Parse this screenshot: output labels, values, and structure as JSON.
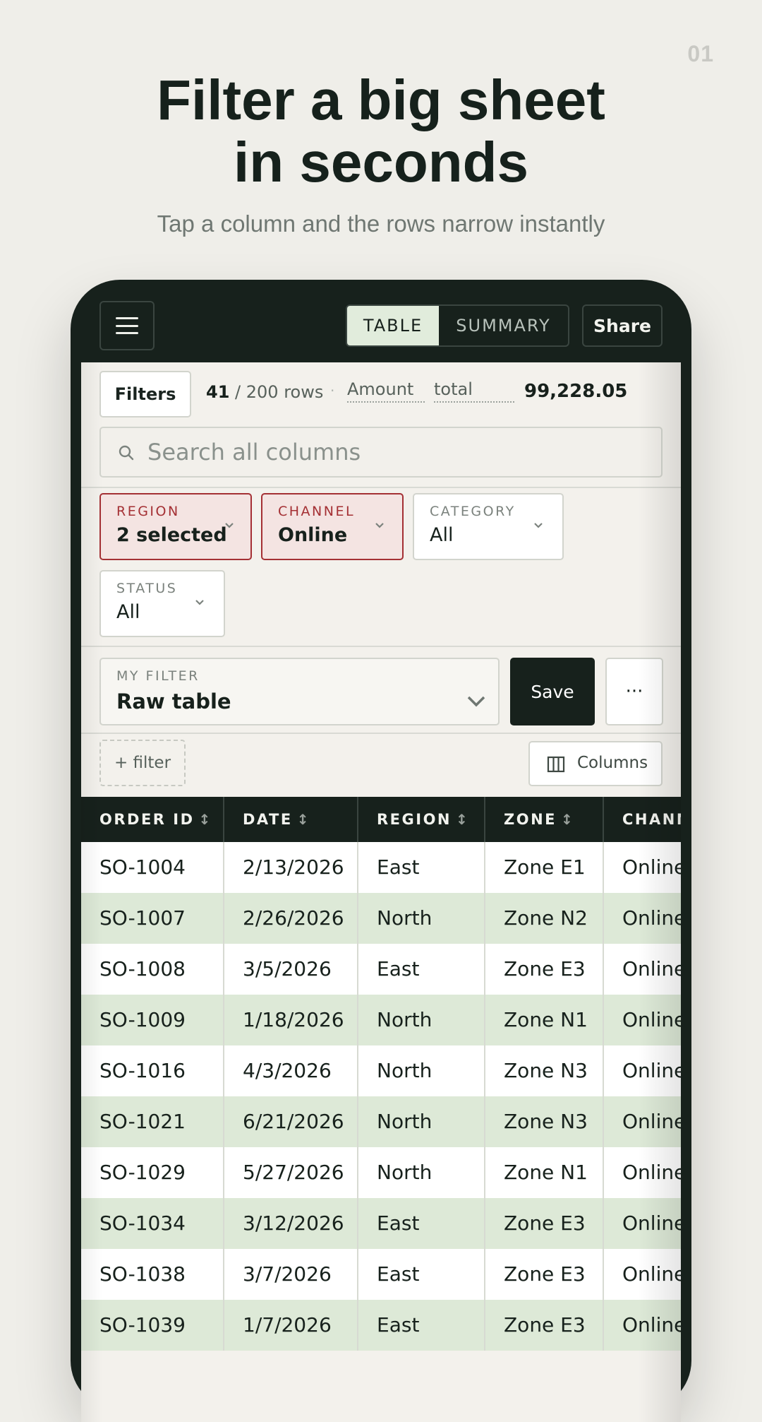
{
  "page_number": "01",
  "hero": {
    "title_line1": "Filter a big sheet",
    "title_line2": "in seconds",
    "subtitle": "Tap a column and the rows narrow instantly"
  },
  "toolbar": {
    "view_tabs": [
      "TABLE",
      "SUMMARY"
    ],
    "active_tab": "TABLE",
    "share_label": "Share"
  },
  "summary": {
    "filters_label": "Filters",
    "rows_shown": "41",
    "rows_total": " / 200 rows",
    "separator": "·",
    "metric_field": "Amount",
    "metric_agg": "total",
    "metric_value": "99,228.05"
  },
  "search": {
    "placeholder": "Search all columns"
  },
  "filter_chips": [
    {
      "label": "REGION",
      "value": "2 selected",
      "active": true
    },
    {
      "label": "CHANNEL",
      "value": "Online",
      "active": true
    },
    {
      "label": "CATEGORY",
      "value": "All",
      "active": false
    },
    {
      "label": "STATUS",
      "value": "All",
      "active": false
    }
  ],
  "saved_filter": {
    "label": "MY FILTER",
    "value": "Raw table",
    "save_label": "Save",
    "more_label": "···"
  },
  "actions": {
    "add_filter_label": "+ filter",
    "columns_label": "Columns"
  },
  "table": {
    "columns": [
      "ORDER ID",
      "DATE",
      "REGION",
      "ZONE",
      "CHANNEL"
    ],
    "sort_icon": "↕",
    "rows": [
      [
        "SO-1004",
        "2/13/2026",
        "East",
        "Zone E1",
        "Online"
      ],
      [
        "SO-1007",
        "2/26/2026",
        "North",
        "Zone N2",
        "Online"
      ],
      [
        "SO-1008",
        "3/5/2026",
        "East",
        "Zone E3",
        "Online"
      ],
      [
        "SO-1009",
        "1/18/2026",
        "North",
        "Zone N1",
        "Online"
      ],
      [
        "SO-1016",
        "4/3/2026",
        "North",
        "Zone N3",
        "Online"
      ],
      [
        "SO-1021",
        "6/21/2026",
        "North",
        "Zone N3",
        "Online"
      ],
      [
        "SO-1029",
        "5/27/2026",
        "North",
        "Zone N1",
        "Online"
      ],
      [
        "SO-1034",
        "3/12/2026",
        "East",
        "Zone E3",
        "Online"
      ],
      [
        "SO-1038",
        "3/7/2026",
        "East",
        "Zone E3",
        "Online"
      ],
      [
        "SO-1039",
        "1/7/2026",
        "East",
        "Zone E3",
        "Online"
      ]
    ]
  },
  "colors": {
    "background": "#efeee9",
    "dark": "#17211c",
    "active_chip_border": "#a43034",
    "active_chip_bg": "#f4e4e2",
    "row_stripe": "#dde9d7"
  }
}
